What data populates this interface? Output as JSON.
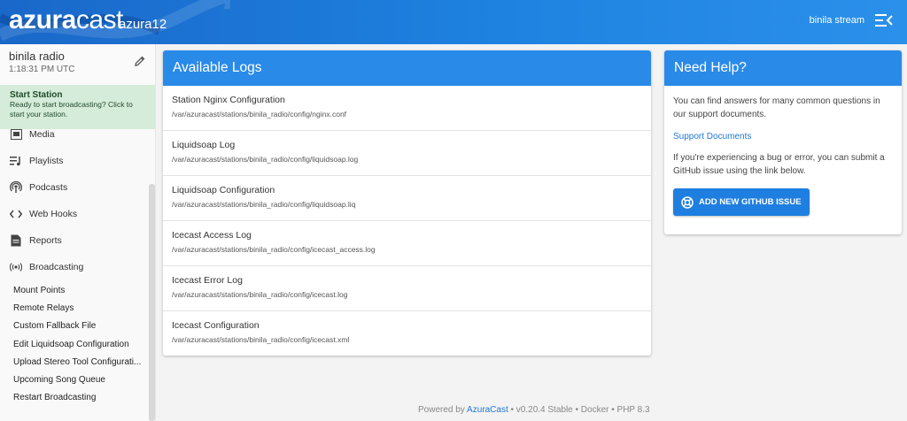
{
  "header": {
    "logo_bold": "azura",
    "logo_rest": "cast",
    "instance": "azura12",
    "user": "binila stream"
  },
  "station": {
    "name": "binila radio",
    "time": "1:18:31 PM UTC"
  },
  "start_station": {
    "title": "Start Station",
    "description": "Ready to start broadcasting? Click to start your station."
  },
  "nav": {
    "items": [
      {
        "label": "Media",
        "icon": "media-icon"
      },
      {
        "label": "Playlists",
        "icon": "playlist-icon"
      },
      {
        "label": "Podcasts",
        "icon": "podcast-icon"
      },
      {
        "label": "Web Hooks",
        "icon": "code-icon"
      },
      {
        "label": "Reports",
        "icon": "report-icon"
      },
      {
        "label": "Broadcasting",
        "icon": "broadcast-icon"
      }
    ],
    "sub_items": [
      "Mount Points",
      "Remote Relays",
      "Custom Fallback File",
      "Edit Liquidsoap Configuration",
      "Upload Stereo Tool Configurati...",
      "Upcoming Song Queue",
      "Restart Broadcasting"
    ]
  },
  "logs": {
    "title": "Available Logs",
    "items": [
      {
        "title": "Station Nginx Configuration",
        "path": "/var/azuracast/stations/binila_radio/config/nginx.conf"
      },
      {
        "title": "Liquidsoap Log",
        "path": "/var/azuracast/stations/binila_radio/config/liquidsoap.log"
      },
      {
        "title": "Liquidsoap Configuration",
        "path": "/var/azuracast/stations/binila_radio/config/liquidsoap.liq"
      },
      {
        "title": "Icecast Access Log",
        "path": "/var/azuracast/stations/binila_radio/config/icecast_access.log"
      },
      {
        "title": "Icecast Error Log",
        "path": "/var/azuracast/stations/binila_radio/config/icecast.log"
      },
      {
        "title": "Icecast Configuration",
        "path": "/var/azuracast/stations/binila_radio/config/icecast.xml"
      }
    ]
  },
  "help": {
    "title": "Need Help?",
    "intro": "You can find answers for many common questions in our support documents.",
    "link": "Support Documents",
    "bug_text": "If you're experiencing a bug or error, you can submit a GitHub issue using the link below.",
    "button": "ADD NEW GITHUB ISSUE"
  },
  "footer": {
    "prefix": "Powered by ",
    "brand": "AzuraCast",
    "suffix": " • v0.20.4 Stable • Docker • PHP 8.3"
  },
  "colors": {
    "header": "#1e82e0",
    "card_header": "#2a8ae8",
    "start_bg": "#d4ecd9",
    "link": "#1e79d6"
  }
}
